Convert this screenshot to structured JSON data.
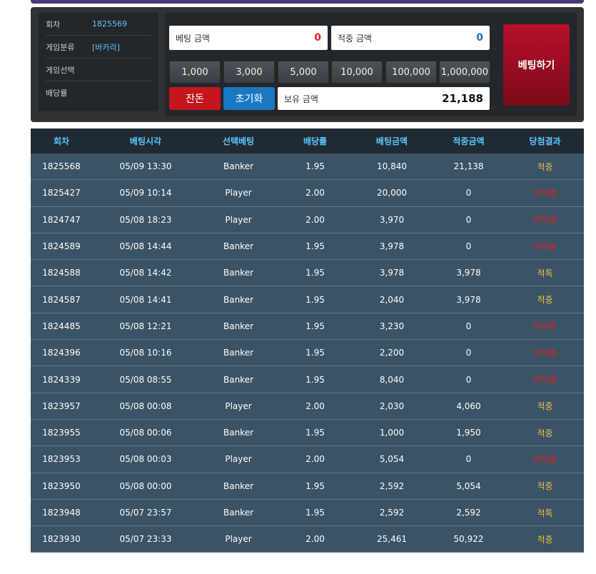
{
  "info": {
    "round_label": "회차",
    "round_value": "1825569",
    "game_type_label": "게임분류",
    "game_type_value": "[바카라]",
    "game_select_label": "게임선택",
    "odds_label": "배당률"
  },
  "bet": {
    "bet_amount_label": "베팅 금액",
    "bet_amount_value": "0",
    "win_amount_label": "적중 금액",
    "win_amount_value": "0",
    "chips": [
      "1,000",
      "3,000",
      "5,000",
      "10,000",
      "100,000",
      "1,000,000"
    ],
    "remainder_label": "잔돈",
    "reset_label": "초기화",
    "balance_label": "보유 금액",
    "balance_value": "21,188",
    "bet_button_label": "베팅하기"
  },
  "table": {
    "headers": [
      "회차",
      "베팅시각",
      "선택베팅",
      "배당률",
      "베팅금액",
      "적중금액",
      "당첨결과"
    ],
    "rows": [
      [
        "1825568",
        "05/09 13:30",
        "Banker",
        "1.95",
        "10,840",
        "21,138",
        "적중"
      ],
      [
        "1825427",
        "05/09 10:14",
        "Player",
        "2.00",
        "20,000",
        "0",
        "미적중"
      ],
      [
        "1824747",
        "05/08 18:23",
        "Player",
        "2.00",
        "3,970",
        "0",
        "미적중"
      ],
      [
        "1824589",
        "05/08 14:44",
        "Banker",
        "1.95",
        "3,978",
        "0",
        "미적중"
      ],
      [
        "1824588",
        "05/08 14:42",
        "Banker",
        "1.95",
        "3,978",
        "3,978",
        "적특"
      ],
      [
        "1824587",
        "05/08 14:41",
        "Banker",
        "1.95",
        "2,040",
        "3,978",
        "적중"
      ],
      [
        "1824485",
        "05/08 12:21",
        "Banker",
        "1.95",
        "3,230",
        "0",
        "미적중"
      ],
      [
        "1824396",
        "05/08 10:16",
        "Banker",
        "1.95",
        "2,200",
        "0",
        "미적중"
      ],
      [
        "1824339",
        "05/08 08:55",
        "Banker",
        "1.95",
        "8,040",
        "0",
        "미적중"
      ],
      [
        "1823957",
        "05/08 00:08",
        "Player",
        "2.00",
        "2,030",
        "4,060",
        "적중"
      ],
      [
        "1823955",
        "05/08 00:06",
        "Banker",
        "1.95",
        "1,000",
        "1,950",
        "적중"
      ],
      [
        "1823953",
        "05/08 00:03",
        "Player",
        "2.00",
        "5,054",
        "0",
        "미적중"
      ],
      [
        "1823950",
        "05/08 00:00",
        "Banker",
        "1.95",
        "2,592",
        "5,054",
        "적중"
      ],
      [
        "1823948",
        "05/07 23:57",
        "Banker",
        "1.95",
        "2,592",
        "2,592",
        "적특"
      ],
      [
        "1823930",
        "05/07 23:33",
        "Player",
        "2.00",
        "25,461",
        "50,922",
        "적중"
      ]
    ]
  },
  "colors": {
    "win": "#f0c040",
    "lose": "#e02020",
    "header_text": "#5cc8ff"
  }
}
